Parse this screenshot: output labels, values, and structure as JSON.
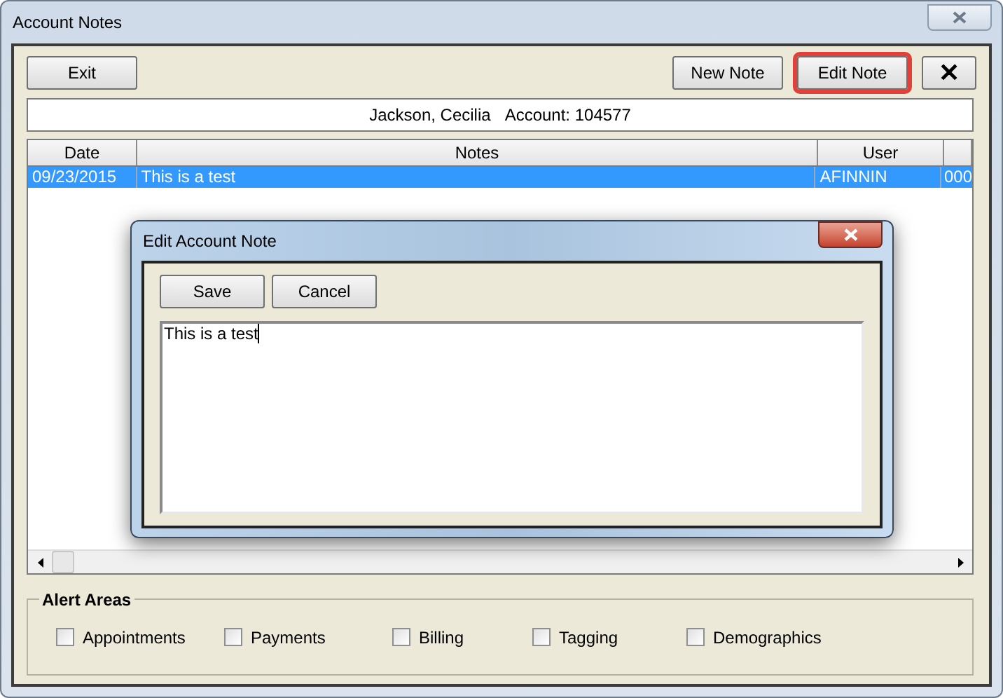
{
  "window": {
    "title": "Account Notes"
  },
  "toolbar": {
    "buttons": [
      {
        "label": "Exit",
        "highlighted": false
      },
      {
        "label": "New Note",
        "highlighted": false
      },
      {
        "label": "Edit Note",
        "highlighted": true
      }
    ],
    "close_label": "✕"
  },
  "account_line": {
    "name": "Jackson, Cecilia",
    "account": "Account: 104577"
  },
  "table": {
    "columns": [
      "Date",
      "Notes",
      "User"
    ],
    "rows": [
      {
        "selected": true,
        "cells": [
          "09/23/2015",
          "This is a test",
          "AFINNIN",
          "000"
        ]
      }
    ]
  },
  "alert_areas": {
    "title": "Alert Areas",
    "options": [
      {
        "label": "Appointments",
        "checked": false
      },
      {
        "label": "Payments",
        "checked": false
      },
      {
        "label": "Billing",
        "checked": false
      },
      {
        "label": "Tagging",
        "checked": false
      },
      {
        "label": "Demographics",
        "checked": false
      }
    ]
  },
  "dialog": {
    "title": "Edit Account Note",
    "buttons": [
      "Save",
      "Cancel"
    ],
    "note": "This is a test"
  }
}
